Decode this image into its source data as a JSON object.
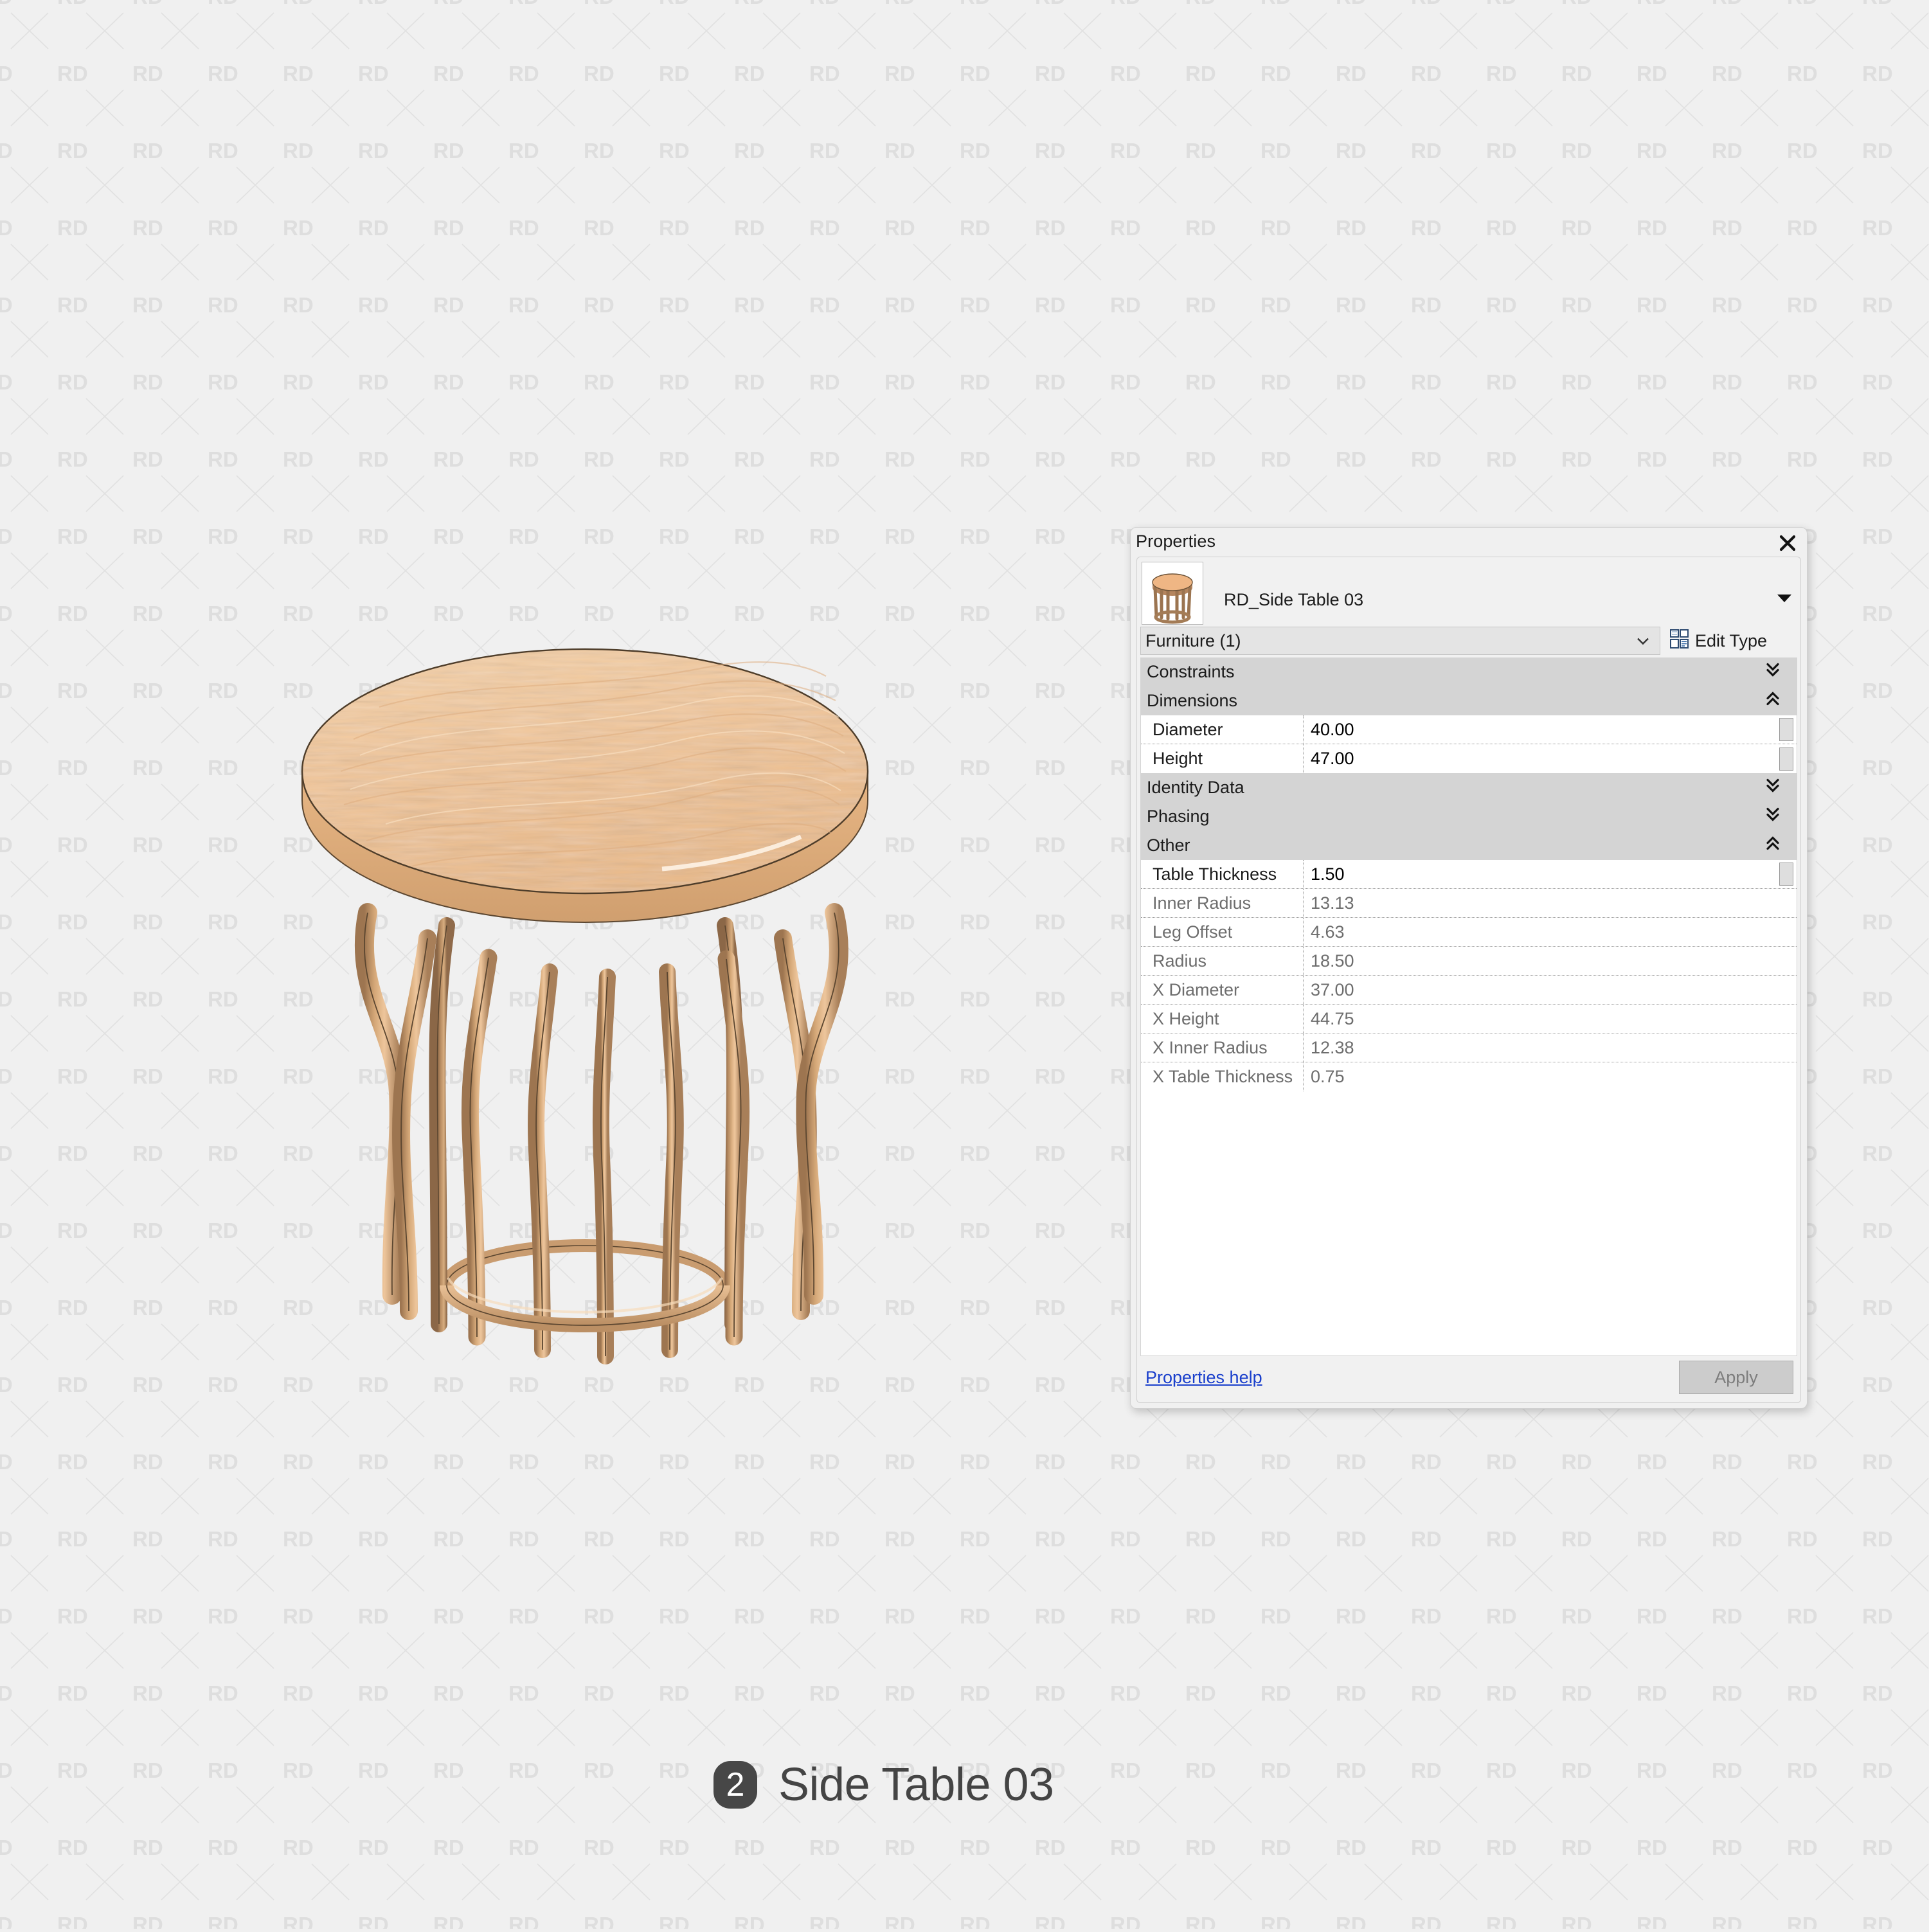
{
  "watermark": {
    "text": "RD"
  },
  "panel": {
    "title": "Properties",
    "close_icon": "close-icon",
    "type_name": "RD_Side Table 03",
    "thumbnail_icon": "side-table-thumbnail",
    "category": "Furniture (1)",
    "edit_type_label": "Edit Type",
    "edit_type_icon": "edit-type-icon",
    "groups": [
      {
        "name": "Constraints",
        "state": "collapsed",
        "chevron": "double-chevron-down-icon",
        "rows": []
      },
      {
        "name": "Dimensions",
        "state": "expanded",
        "chevron": "double-chevron-up-icon",
        "rows": [
          {
            "label": "Diameter",
            "value": "40.00",
            "editable": true,
            "stepper": true
          },
          {
            "label": "Height",
            "value": "47.00",
            "editable": true,
            "stepper": true
          }
        ]
      },
      {
        "name": "Identity Data",
        "state": "collapsed",
        "chevron": "double-chevron-down-icon",
        "rows": []
      },
      {
        "name": "Phasing",
        "state": "collapsed",
        "chevron": "double-chevron-down-icon",
        "rows": []
      },
      {
        "name": "Other",
        "state": "expanded",
        "chevron": "double-chevron-up-icon",
        "rows": [
          {
            "label": "Table Thickness",
            "value": "1.50",
            "editable": true,
            "stepper": true
          },
          {
            "label": "Inner Radius",
            "value": "13.13",
            "editable": false,
            "stepper": false
          },
          {
            "label": "Leg Offset",
            "value": "4.63",
            "editable": false,
            "stepper": false
          },
          {
            "label": "Radius",
            "value": "18.50",
            "editable": false,
            "stepper": false
          },
          {
            "label": "X Diameter",
            "value": "37.00",
            "editable": false,
            "stepper": false
          },
          {
            "label": "X Height",
            "value": "44.75",
            "editable": false,
            "stepper": false
          },
          {
            "label": "X Inner Radius",
            "value": "12.38",
            "editable": false,
            "stepper": false
          },
          {
            "label": "X Table Thickness",
            "value": "0.75",
            "editable": false,
            "stepper": false
          }
        ]
      }
    ],
    "help_link": "Properties help",
    "apply_label": "Apply"
  },
  "caption": {
    "badge_number": "2",
    "title": "Side Table 03"
  },
  "colors": {
    "page_background": "#f0f0f0",
    "panel_background": "#f0f0f0",
    "group_header": "#d4d4d4",
    "link": "#1a3fcc",
    "badge": "#474747",
    "caption_text": "#444444",
    "wood_top": "#f0c79a",
    "wood_leg": "#c79a72"
  }
}
